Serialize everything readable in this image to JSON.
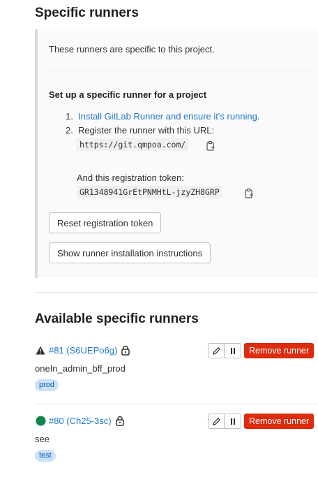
{
  "specific": {
    "title": "Specific runners",
    "intro": "These runners are specific to this project.",
    "setup_title": "Set up a specific runner for a project",
    "step1_num": "1.",
    "step1_link": "Install GitLab Runner and ensure it's running.",
    "step2_num": "2.",
    "step2_text": "Register the runner with this URL:",
    "url": "https://git.qmpoa.com/",
    "token_label": "And this registration token:",
    "token": "GR1348941GrEtPNMHtL-jzyZH8GRP",
    "reset_button": "Reset registration token",
    "instructions_button": "Show runner installation instructions"
  },
  "available": {
    "title": "Available specific runners",
    "runners": [
      {
        "id_label": "#81 (S6UEPo6g)",
        "status": "warning",
        "status_icon": "warning-triangle-icon",
        "description": "oneIn_admin_bff_prod",
        "tag": "prod",
        "remove_label": "Remove runner"
      },
      {
        "id_label": "#80 (Ch25-3sc)",
        "status": "online",
        "status_icon": "online-circle-icon",
        "description": "see",
        "tag": "test",
        "remove_label": "Remove runner"
      }
    ]
  },
  "colors": {
    "link": "#1f75cb",
    "danger": "#dd2b0e",
    "online": "#108548",
    "tag_bg": "#cbe2f9"
  }
}
